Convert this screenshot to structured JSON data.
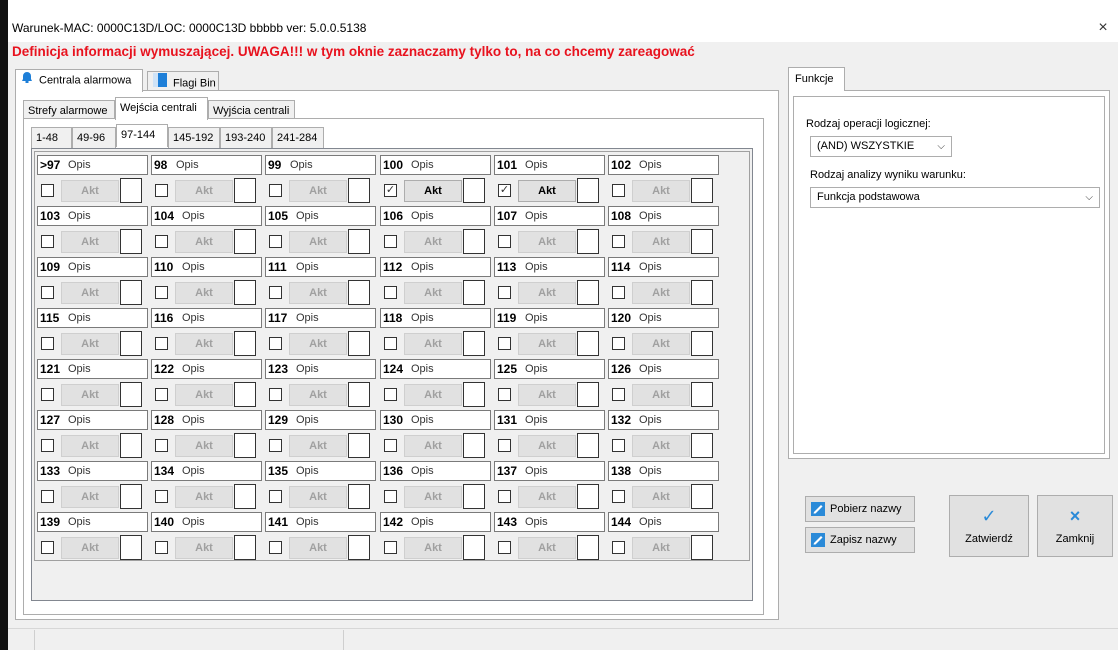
{
  "window": {
    "title": "Warunek-MAC: 0000C13D/LOC: 0000C13D bbbbb ver: 5.0.0.5138",
    "close_glyph": "×",
    "warning": "Definicja informacji wymuszającej. UWAGA!!! w tym oknie zaznaczamy tylko to, na co chcemy zareagować"
  },
  "main_tabs": [
    {
      "label": "Centrala alarmowa",
      "icon": "bell-icon",
      "active": true
    },
    {
      "label": "Flagi Bin",
      "icon": "flag-icon",
      "active": false
    }
  ],
  "sub_tabs": [
    {
      "label": "Strefy alarmowe",
      "active": false
    },
    {
      "label": "Wejścia centrali",
      "active": true
    },
    {
      "label": "Wyjścia centrali",
      "active": false
    }
  ],
  "range_tabs": [
    {
      "label": "1-48",
      "active": false
    },
    {
      "label": "49-96",
      "active": false
    },
    {
      "label": "97-144",
      "active": true
    },
    {
      "label": "145-192",
      "active": false
    },
    {
      "label": "193-240",
      "active": false
    },
    {
      "label": "241-284",
      "active": false
    }
  ],
  "grid": {
    "opis_label": "Opis",
    "akt_label": "Akt",
    "check_glyph": "✓",
    "cells": [
      {
        "num": ">97",
        "checked": false,
        "akt_enabled": false
      },
      {
        "num": "98",
        "checked": false,
        "akt_enabled": false
      },
      {
        "num": "99",
        "checked": false,
        "akt_enabled": false
      },
      {
        "num": "100",
        "checked": true,
        "akt_enabled": true
      },
      {
        "num": "101",
        "checked": true,
        "akt_enabled": true
      },
      {
        "num": "102",
        "checked": false,
        "akt_enabled": false
      },
      {
        "num": "103",
        "checked": false,
        "akt_enabled": false
      },
      {
        "num": "104",
        "checked": false,
        "akt_enabled": false
      },
      {
        "num": "105",
        "checked": false,
        "akt_enabled": false
      },
      {
        "num": "106",
        "checked": false,
        "akt_enabled": false
      },
      {
        "num": "107",
        "checked": false,
        "akt_enabled": false
      },
      {
        "num": "108",
        "checked": false,
        "akt_enabled": false
      },
      {
        "num": "109",
        "checked": false,
        "akt_enabled": false
      },
      {
        "num": "110",
        "checked": false,
        "akt_enabled": false
      },
      {
        "num": "111",
        "checked": false,
        "akt_enabled": false
      },
      {
        "num": "112",
        "checked": false,
        "akt_enabled": false
      },
      {
        "num": "113",
        "checked": false,
        "akt_enabled": false
      },
      {
        "num": "114",
        "checked": false,
        "akt_enabled": false
      },
      {
        "num": "115",
        "checked": false,
        "akt_enabled": false
      },
      {
        "num": "116",
        "checked": false,
        "akt_enabled": false
      },
      {
        "num": "117",
        "checked": false,
        "akt_enabled": false
      },
      {
        "num": "118",
        "checked": false,
        "akt_enabled": false
      },
      {
        "num": "119",
        "checked": false,
        "akt_enabled": false
      },
      {
        "num": "120",
        "checked": false,
        "akt_enabled": false
      },
      {
        "num": "121",
        "checked": false,
        "akt_enabled": false
      },
      {
        "num": "122",
        "checked": false,
        "akt_enabled": false
      },
      {
        "num": "123",
        "checked": false,
        "akt_enabled": false
      },
      {
        "num": "124",
        "checked": false,
        "akt_enabled": false
      },
      {
        "num": "125",
        "checked": false,
        "akt_enabled": false
      },
      {
        "num": "126",
        "checked": false,
        "akt_enabled": false
      },
      {
        "num": "127",
        "checked": false,
        "akt_enabled": false
      },
      {
        "num": "128",
        "checked": false,
        "akt_enabled": false
      },
      {
        "num": "129",
        "checked": false,
        "akt_enabled": false
      },
      {
        "num": "130",
        "checked": false,
        "akt_enabled": false
      },
      {
        "num": "131",
        "checked": false,
        "akt_enabled": false
      },
      {
        "num": "132",
        "checked": false,
        "akt_enabled": false
      },
      {
        "num": "133",
        "checked": false,
        "akt_enabled": false
      },
      {
        "num": "134",
        "checked": false,
        "akt_enabled": false
      },
      {
        "num": "135",
        "checked": false,
        "akt_enabled": false
      },
      {
        "num": "136",
        "checked": false,
        "akt_enabled": false
      },
      {
        "num": "137",
        "checked": false,
        "akt_enabled": false
      },
      {
        "num": "138",
        "checked": false,
        "akt_enabled": false
      },
      {
        "num": "139",
        "checked": false,
        "akt_enabled": false
      },
      {
        "num": "140",
        "checked": false,
        "akt_enabled": false
      },
      {
        "num": "141",
        "checked": false,
        "akt_enabled": false
      },
      {
        "num": "142",
        "checked": false,
        "akt_enabled": false
      },
      {
        "num": "143",
        "checked": false,
        "akt_enabled": false
      },
      {
        "num": "144",
        "checked": false,
        "akt_enabled": false
      }
    ]
  },
  "functions": {
    "tab_label": "Funkcje",
    "logic_label": "Rodzaj operacji logicznej:",
    "logic_value": "(AND) WSZYSTKIE",
    "analysis_label": "Rodzaj analizy wyniku warunku:",
    "analysis_value": "Funkcja podstawowa",
    "chevron_glyph": "⌵"
  },
  "buttons": {
    "fetch_names": "Pobierz nazwy",
    "save_names": "Zapisz nazwy",
    "confirm": "Zatwierdź",
    "confirm_glyph": "✓",
    "close": "Zamknij",
    "close_glyph": "×"
  },
  "colors": {
    "warning": "#e8121e",
    "icon_blue": "#1e7fd8",
    "confirm_blue": "#2a8ad8"
  }
}
